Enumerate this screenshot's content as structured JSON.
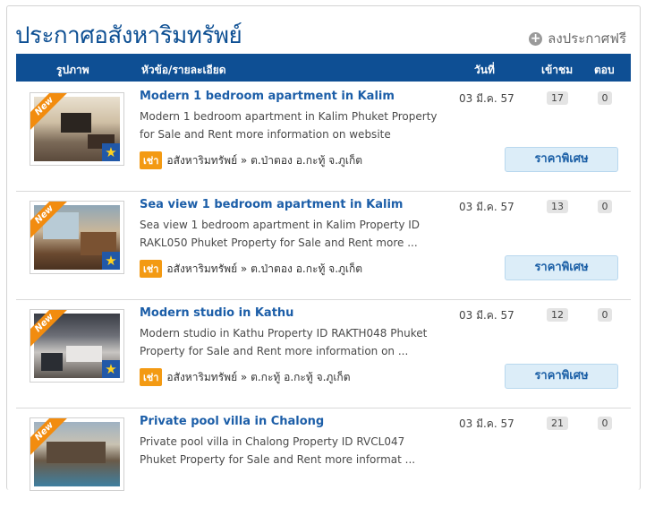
{
  "page": {
    "title": "ประกาศอสังหาริมทรัพย์",
    "post_free_label": "ลงประกาศฟรี"
  },
  "columns": {
    "image": "รูปภาพ",
    "title_detail": "หัวข้อ/รายละเอียด",
    "date": "วันที่",
    "views": "เข้าชม",
    "replies": "ตอบ"
  },
  "badges": {
    "new_label": "New",
    "rent_label": "เช่า",
    "special_price_label": "ราคาพิเศษ",
    "star_icon": "star-icon",
    "plus_icon": "plus-circle-icon"
  },
  "colors": {
    "brand_blue": "#0e4f94",
    "link_blue": "#1c5ea8",
    "ribbon_orange": "#f28c0f",
    "rent_orange": "#f39a13",
    "button_bg": "#dcedf8"
  },
  "listings": [
    {
      "title": "Modern 1 bedroom apartment in Kalim",
      "description": "Modern 1 bedroom apartment in Kalim Phuket Property for Sale and Rent more information on website",
      "category_path": "อสังหาริมทรัพย์ » ต.ป่าตอง อ.กะทู้ จ.ภูเก็ต",
      "date": "03 มี.ค. 57",
      "views": "17",
      "replies": "0"
    },
    {
      "title": "Sea view 1 bedroom apartment in Kalim",
      "description": "Sea view 1 bedroom apartment in Kalim Property ID RAKL050 Phuket Property for Sale and Rent more ...",
      "category_path": "อสังหาริมทรัพย์ » ต.ป่าตอง อ.กะทู้ จ.ภูเก็ต",
      "date": "03 มี.ค. 57",
      "views": "13",
      "replies": "0"
    },
    {
      "title": "Modern studio in Kathu",
      "description": "Modern studio in Kathu Property ID RAKTH048 Phuket Property for Sale and Rent more information on ...",
      "category_path": "อสังหาริมทรัพย์ » ต.กะทู้ อ.กะทู้ จ.ภูเก็ต",
      "date": "03 มี.ค. 57",
      "views": "12",
      "replies": "0"
    },
    {
      "title": "Private pool villa in Chalong",
      "description": "Private pool villa in Chalong Property ID RVCL047 Phuket Property for Sale and Rent more informat ...",
      "category_path": "",
      "date": "03 มี.ค. 57",
      "views": "21",
      "replies": "0"
    }
  ]
}
